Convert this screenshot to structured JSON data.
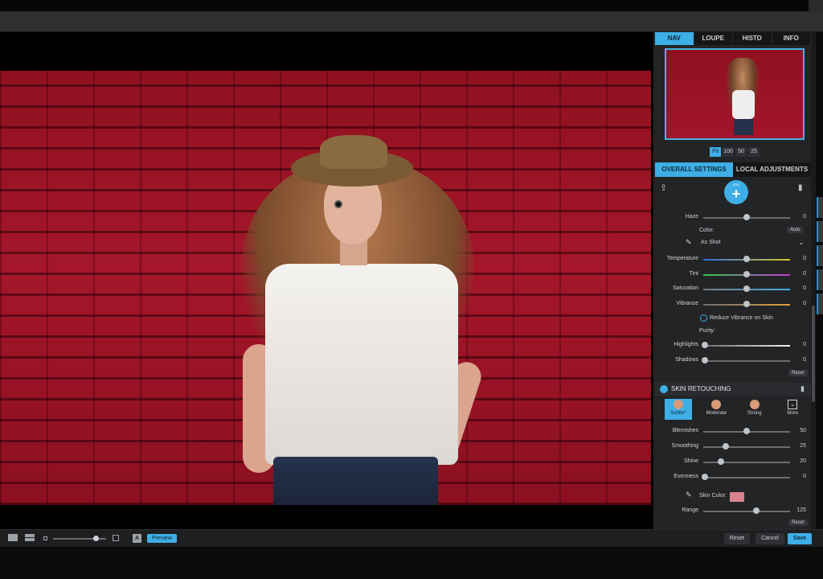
{
  "nav_tabs": [
    "NAV",
    "LOUPE",
    "HISTO",
    "INFO"
  ],
  "zoom_levels": [
    "Fit",
    "100",
    "50",
    "25"
  ],
  "settings_tabs": [
    "OVERALL SETTINGS",
    "LOCAL ADJUSTMENTS"
  ],
  "add_button": {
    "label": "ADD"
  },
  "haze": {
    "label": "Haze",
    "value": "0",
    "level": 0.5
  },
  "color": {
    "label": "Color:",
    "auto_label": "Auto",
    "preset": "As Shot",
    "sliders": [
      {
        "label": "Temperature",
        "value": "0",
        "level": 0.5
      },
      {
        "label": "Tint",
        "value": "0",
        "level": 0.5
      },
      {
        "label": "Saturation",
        "value": "0",
        "level": 0.5
      },
      {
        "label": "Vibrance",
        "value": "0",
        "level": 0.5
      }
    ],
    "reduce_vibrance_label": "Reduce Vibrance on Skin"
  },
  "purity": {
    "label": "Purity:",
    "sliders": [
      {
        "label": "Highlights",
        "value": "0",
        "level": 0.0
      },
      {
        "label": "Shadows",
        "value": "0",
        "level": 0.0
      }
    ],
    "reset_label": "Reset"
  },
  "skin": {
    "title": "SKIN RETOUCHING",
    "presets": [
      "Subtle*",
      "Moderate",
      "Strong",
      "More"
    ],
    "active_preset": "Subtle*",
    "sliders": [
      {
        "label": "Blemishes",
        "value": "50",
        "level": 0.5
      },
      {
        "label": "Smoothing",
        "value": "25",
        "level": 0.25
      },
      {
        "label": "Shine",
        "value": "20",
        "level": 0.2
      },
      {
        "label": "Evenness",
        "value": "0",
        "level": 0.0
      }
    ],
    "skin_color_label": "Skin Color:",
    "skin_color": "#d9838f",
    "range_label": "Range",
    "range_value": "125",
    "range_level": 0.6,
    "reset_label": "Reset"
  },
  "bottom": {
    "preview_label": "Preview",
    "compare_label": "A",
    "reset_label": "Reset",
    "cancel_label": "Cancel",
    "save_label": "Save"
  },
  "accent_color": "#3eaee6"
}
